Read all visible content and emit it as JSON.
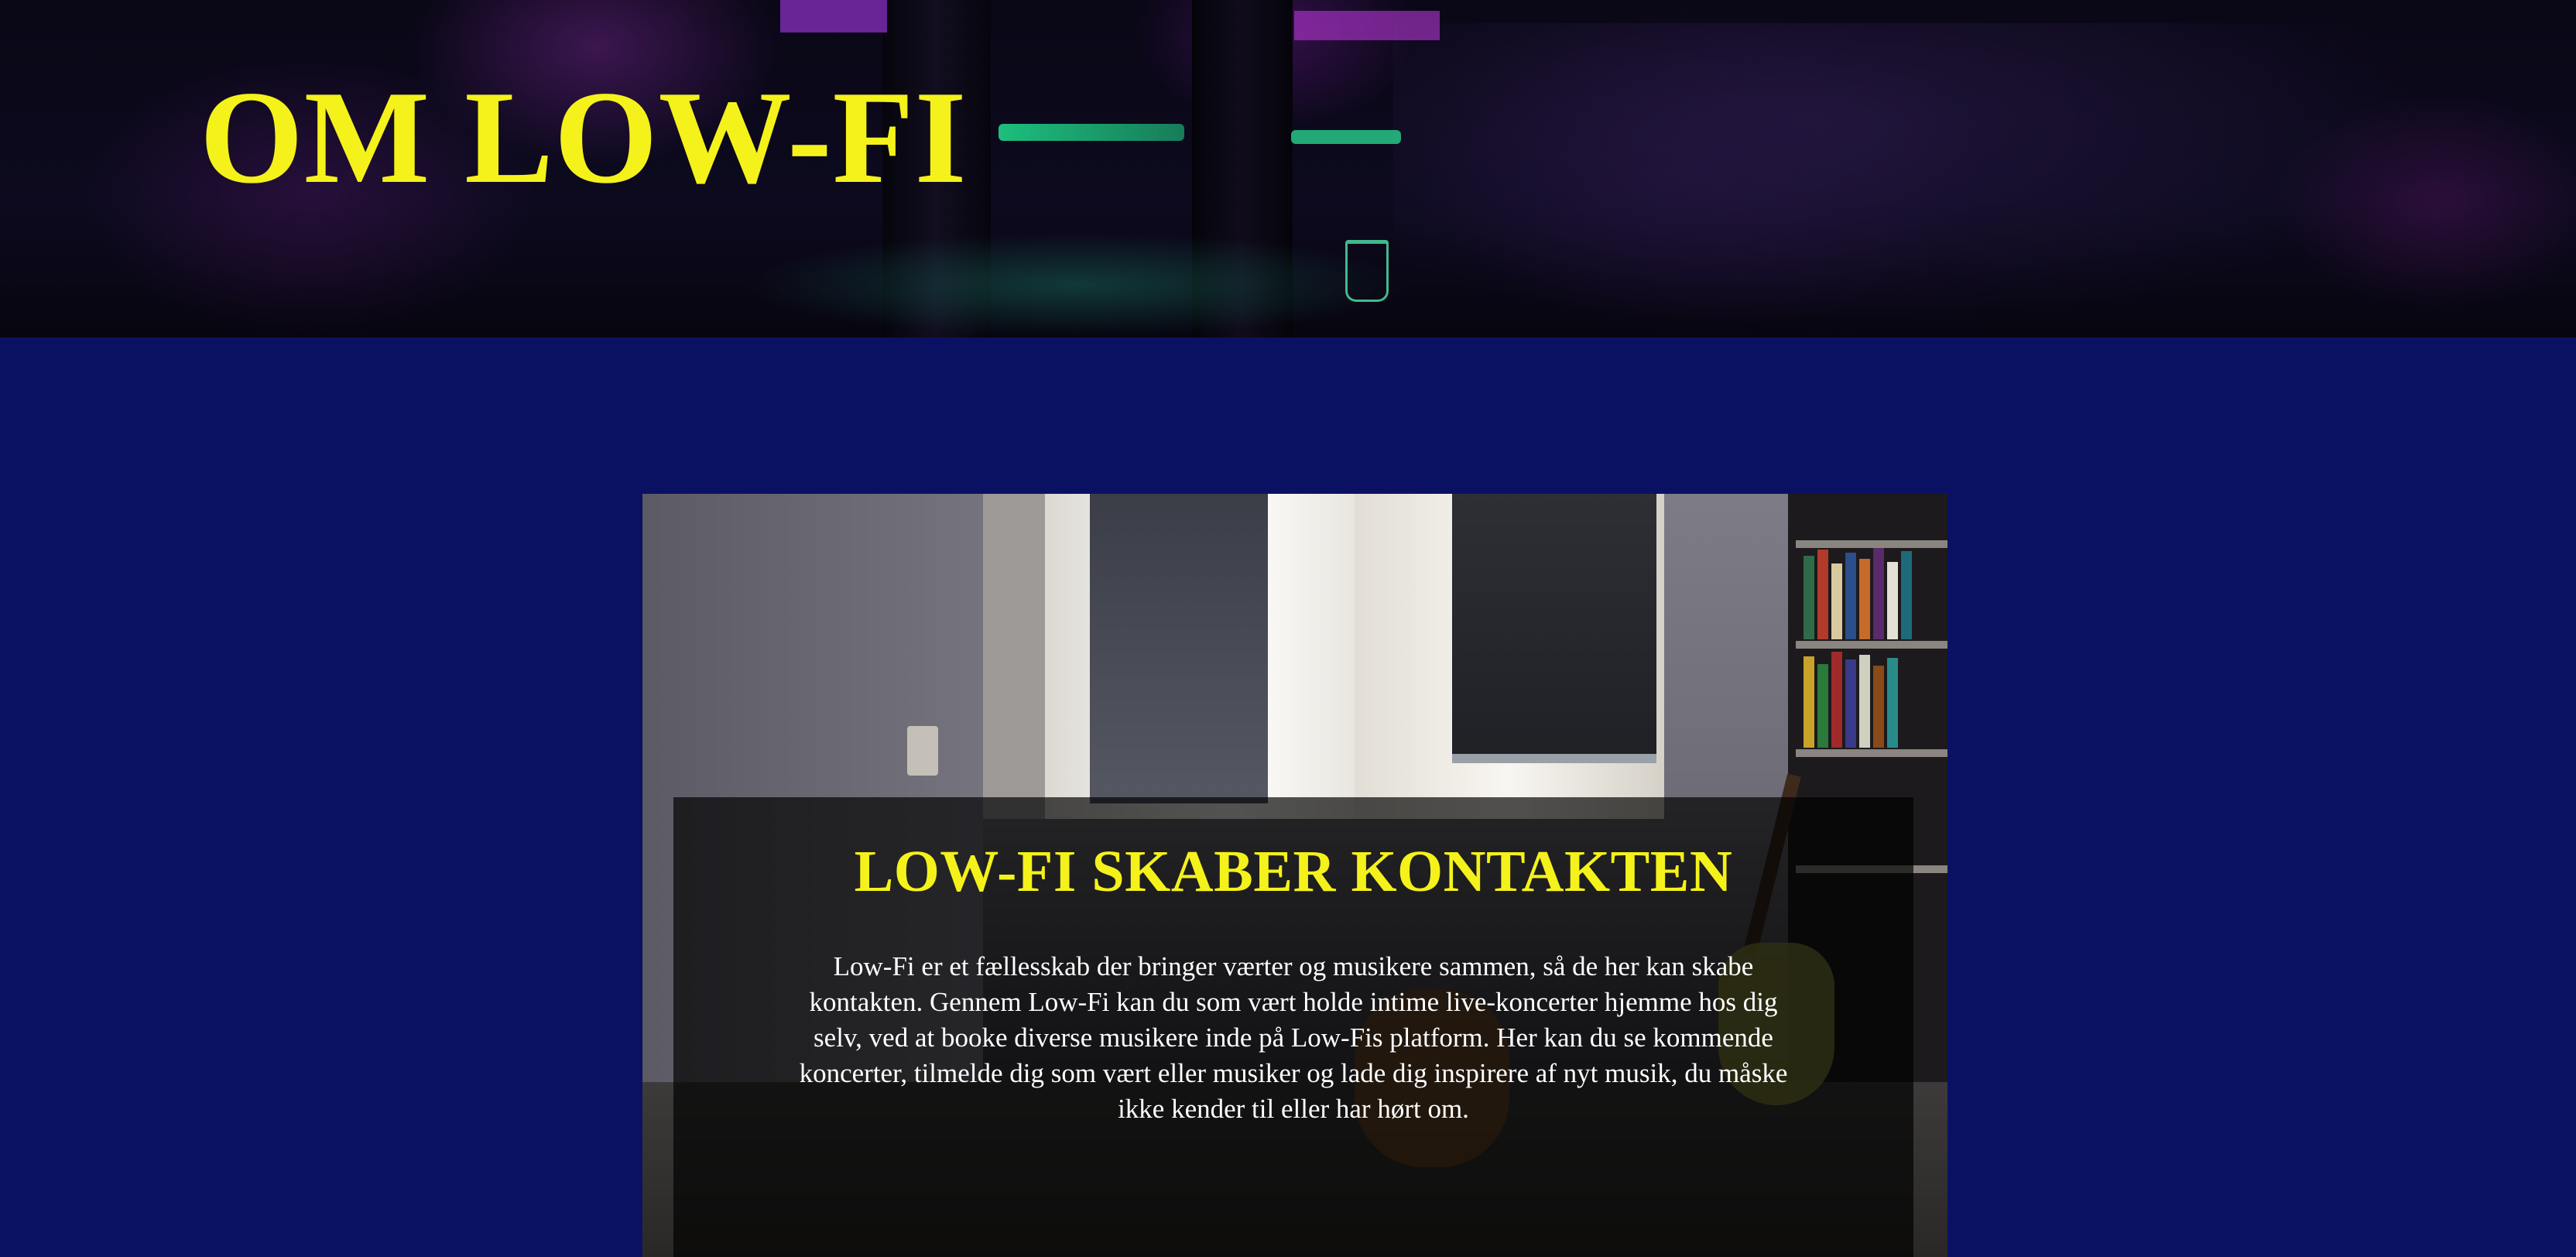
{
  "hero": {
    "title": "OM LOW-FI"
  },
  "about": {
    "heading": "LOW-FI SKABER KONTAKTEN",
    "body": "Low-Fi er et fællesskab der bringer værter og musikere sammen, så de her kan skabe kontakten. Gennem Low-Fi kan du som vært holde intime live-koncerter hjemme hos dig selv, ved at booke diverse musikere inde på Low-Fis platform. Her kan du se kommende koncerter, tilmelde dig som vært eller musiker og lade dig inspirere af nyt musik, du måske ikke kender til eller har hørt om."
  },
  "colors": {
    "page_background": "#0b1162",
    "accent_yellow": "#f4f21a",
    "panel_overlay": "rgba(0,0,0,0.68)",
    "body_text": "#ffffff"
  }
}
